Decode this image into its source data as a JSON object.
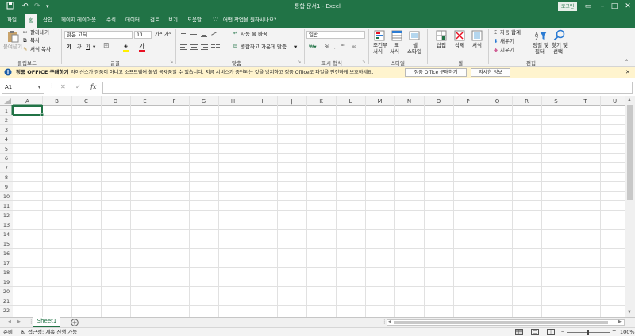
{
  "title": "통합 문서1 - Excel",
  "login_label": "로그인",
  "colors": {
    "brand": "#217346",
    "message_bar": "#fff4ce"
  },
  "tabs": [
    "파일",
    "홈",
    "삽입",
    "페이지 레이아웃",
    "수식",
    "데이터",
    "검토",
    "보기",
    "도움말"
  ],
  "tell_me": "어떤 작업을 원하시나요?",
  "ribbon": {
    "clipboard": {
      "paste": "붙여넣기",
      "cut": "잘라내기",
      "copy": "복사",
      "format_painter": "서식 복사",
      "label": "클립보드"
    },
    "font": {
      "name": "맑은 고딕",
      "size": "11",
      "bold": "가",
      "italic": "가",
      "underline": "가",
      "label": "글꼴"
    },
    "alignment": {
      "wrap": "자동 줄 바꿈",
      "merge": "병합하고 가운데 맞춤",
      "label": "맞춤"
    },
    "number": {
      "format": "일반",
      "label": "표시 형식"
    },
    "styles": {
      "conditional_top": "조건부",
      "conditional_bottom": "서식",
      "table_top": "표",
      "table_bottom": "서식",
      "cell_top": "셀",
      "cell_bottom": "스타일",
      "label": "스타일"
    },
    "cells": {
      "insert": "삽입",
      "delete": "삭제",
      "format": "서식",
      "label": "셀"
    },
    "editing": {
      "autosum": "자동 합계",
      "fill": "채우기",
      "clear": "지우기",
      "sort_top": "정렬 및",
      "sort_bottom": "필터",
      "find_top": "찾기 및",
      "find_bottom": "선택",
      "label": "편집"
    }
  },
  "message": {
    "title": "정품 OFFICE 구매하기",
    "text": "라이선스가 정품이 아니고 소프트웨어 불법 복제품일 수 있습니다. 지금 서비스가 중단되는 것을 방지하고 정품 Office로 파일을 안전하게 보호하세요.",
    "buy_button": "정품 Office 구매하기",
    "details_button": "자세한 정보"
  },
  "name_box": "A1",
  "columns": [
    "A",
    "B",
    "C",
    "D",
    "E",
    "F",
    "G",
    "H",
    "I",
    "J",
    "K",
    "L",
    "M",
    "N",
    "O",
    "P",
    "Q",
    "R",
    "S",
    "T",
    "U"
  ],
  "rows": [
    "1",
    "2",
    "3",
    "4",
    "5",
    "6",
    "7",
    "8",
    "9",
    "10",
    "11",
    "12",
    "13",
    "14",
    "15",
    "16",
    "17",
    "18",
    "19",
    "20",
    "21",
    "22"
  ],
  "sheets": [
    "Sheet1"
  ],
  "status": {
    "ready": "준비",
    "accessibility": "접근성: 계속 진행 가능",
    "zoom": "100%"
  }
}
